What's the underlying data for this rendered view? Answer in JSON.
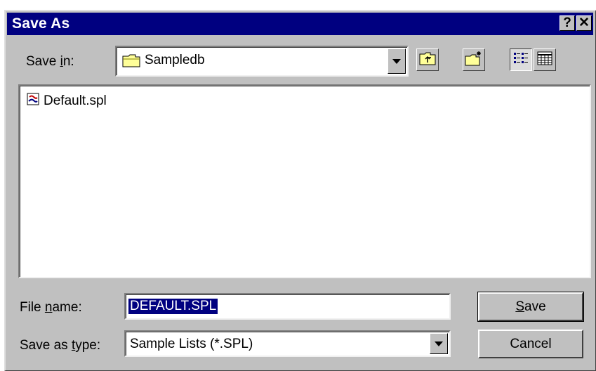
{
  "window": {
    "title": "Save As"
  },
  "titlebar": {
    "help_label": "?",
    "close_label": "✕"
  },
  "save_in": {
    "label_pre": "Save ",
    "label_accel": "i",
    "label_post": "n:",
    "value": "Sampledb"
  },
  "toolbar": {
    "up_one_level_icon": "folder-up-icon",
    "new_folder_icon": "new-folder-icon",
    "list_view_icon": "list-view-icon",
    "details_view_icon": "details-view-icon"
  },
  "files": [
    {
      "name": "Default.spl",
      "icon": "spl-file-icon"
    }
  ],
  "file_name": {
    "label_pre": "File ",
    "label_accel": "n",
    "label_post": "ame:",
    "value": "DEFAULT.SPL"
  },
  "save_as_type": {
    "label_pre": "Save as ",
    "label_accel": "t",
    "label_post": "ype:",
    "value": "Sample Lists (*.SPL)"
  },
  "buttons": {
    "save_accel": "S",
    "save_rest": "ave",
    "cancel_label": "Cancel"
  },
  "colors": {
    "titlebar": "#000080",
    "dialog_face": "#c0c0c0",
    "selection": "#000080"
  }
}
